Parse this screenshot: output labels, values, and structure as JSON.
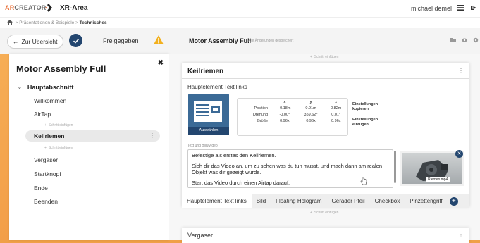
{
  "topbar": {
    "logo_ar": "AR",
    "logo_rest": "CREATOR",
    "app_title": "XR-Area",
    "user_name": "michael demel"
  },
  "breadcrumb": {
    "item1": "Präsentationen & Beispiele",
    "item2": "Technisches"
  },
  "controls": {
    "back_label": "Zur Übersicht",
    "released_label": "Freigegeben",
    "doc_title": "Motor Assembly Full",
    "doc_status": "Alle Änderungen gespeichert"
  },
  "sidebar": {
    "title": "Motor Assembly Full",
    "section": "Hauptabschnitt",
    "items": [
      "Willkommen",
      "AirTap",
      "Keilriemen",
      "Vergaser",
      "Startknopf",
      "Ende",
      "Beenden"
    ],
    "add_label": "Schritt einfügen"
  },
  "main": {
    "add_label": "Schritt einfügen",
    "panel_title": "Keilriemen",
    "sub_title": "Hauptelement Text links",
    "select_button": "Auswählen",
    "table": {
      "headers": [
        "",
        "x",
        "y",
        "z"
      ],
      "rows": [
        [
          "Position",
          "-0.18m",
          "0.91m",
          "0.82m"
        ],
        [
          "Drehung",
          "-0.00°",
          "359.62°",
          "0.01°"
        ],
        [
          "Größe",
          "0.96x",
          "0.96x",
          "0.96x"
        ]
      ]
    },
    "settings_copy": [
      "Einstellungen",
      "kopieren"
    ],
    "settings_paste": [
      "Einstellungen",
      "einfügen"
    ],
    "text_label": "Text und Bild/Video",
    "text_lines": [
      "Befestige als erstes den Keilriemen.",
      "Sieh dir das Video an, um zu sehen was du tun musst, und mach dann am realen Objekt was dir gezeigt wurde.",
      "Start das Video durch einen Airtap darauf."
    ],
    "video_label": "Riemen.mp4",
    "tabs": [
      "Hauptelement Text links",
      "Bild",
      "Floating Hologram",
      "Gerader Pfeil",
      "Checkbox",
      "Pinzettengriff"
    ],
    "next_panel_title": "Vergaser"
  },
  "colors": {
    "accent_orange": "#e8713a",
    "navy": "#23466f",
    "warning": "#f2b01e"
  }
}
